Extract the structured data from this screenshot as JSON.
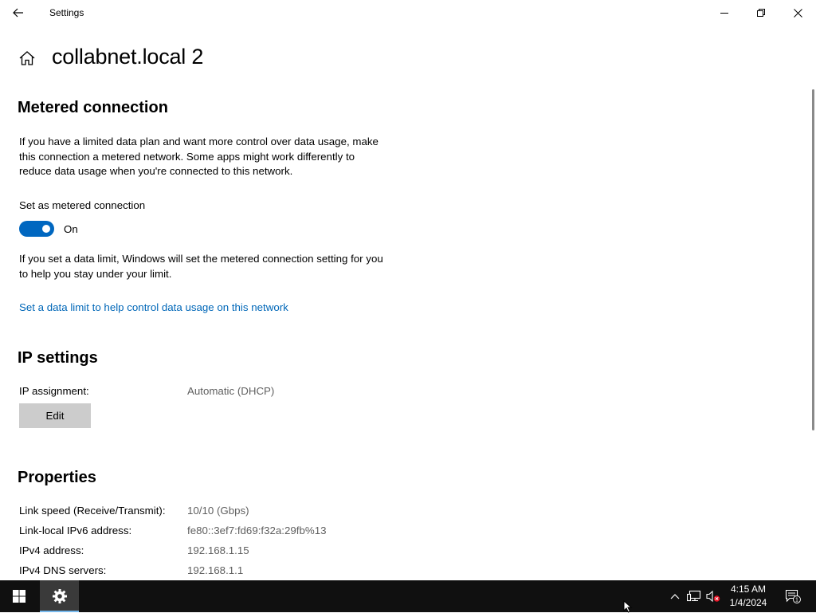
{
  "window": {
    "title": "Settings"
  },
  "header": {
    "page_title": "collabnet.local 2"
  },
  "metered": {
    "heading": "Metered connection",
    "description": "If you have a limited data plan and want more control over data usage, make this connection a metered network. Some apps might work differently to reduce data usage when you're connected to this network.",
    "toggle_label": "Set as metered connection",
    "toggle_state": "On",
    "toggle_on": true,
    "data_limit_note": "If you set a data limit, Windows will set the metered connection setting for you to help you stay under your limit.",
    "data_limit_link": "Set a data limit to help control data usage on this network"
  },
  "ip_settings": {
    "heading": "IP settings",
    "assignment_label": "IP assignment:",
    "assignment_value": "Automatic (DHCP)",
    "edit_label": "Edit"
  },
  "properties": {
    "heading": "Properties",
    "rows": [
      {
        "label": "Link speed (Receive/Transmit):",
        "value": "10/10 (Gbps)"
      },
      {
        "label": "Link-local IPv6 address:",
        "value": "fe80::3ef7:fd69:f32a:29fb%13"
      },
      {
        "label": "IPv4 address:",
        "value": "192.168.1.15"
      },
      {
        "label": "IPv4 DNS servers:",
        "value": "192.168.1.1"
      }
    ]
  },
  "taskbar": {
    "time": "4:15 AM",
    "date": "1/4/2024",
    "notification_count": "1",
    "icons": [
      "windows-start-icon",
      "settings-gear-icon",
      "chevron-up-icon",
      "network-icon",
      "volume-muted-icon",
      "action-center-icon"
    ]
  },
  "colors": {
    "accent": "#0067c0",
    "link": "#0067b8",
    "taskbar": "#101010",
    "button": "#cccccc"
  }
}
